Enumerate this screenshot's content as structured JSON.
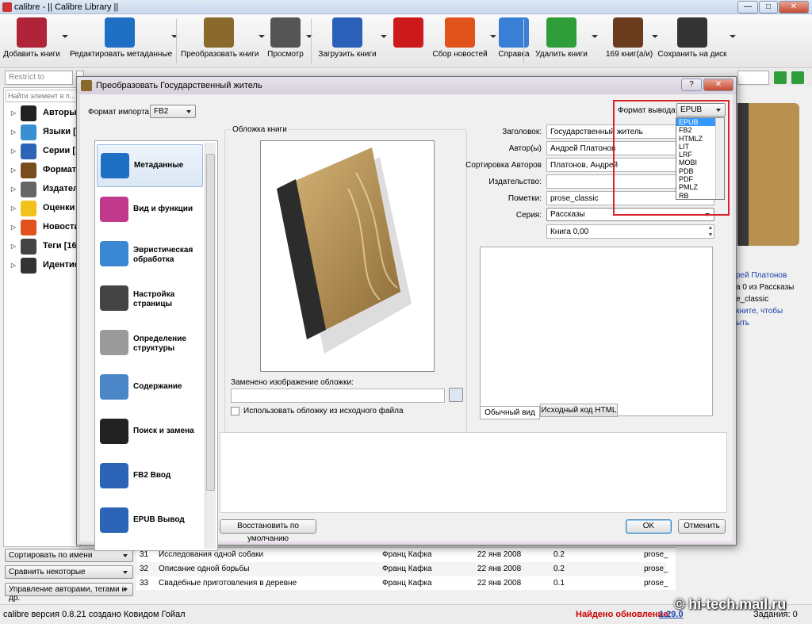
{
  "window": {
    "title": "calibre - || Calibre Library ||",
    "min": "—",
    "max": "□",
    "close": "✕"
  },
  "toolbar": [
    {
      "label": "Добавить книги",
      "icon": "add-book-icon",
      "color": "#b0243a",
      "arrow": true
    },
    {
      "label": "Редактировать метаданные",
      "icon": "info-icon",
      "color": "#1f6fc4",
      "arrow": true
    },
    {
      "label": "Преобразовать книги",
      "icon": "convert-icon",
      "color": "#8a6a2c",
      "arrow": true
    },
    {
      "label": "Просмотр",
      "icon": "magnifier-icon",
      "color": "#555555",
      "arrow": true
    },
    {
      "label": "Загрузить книги",
      "icon": "globe-icon",
      "color": "#2b5fb8",
      "arrow": true
    },
    {
      "label": "",
      "icon": "heart-icon",
      "color": "#cc1a1a",
      "arrow": false
    },
    {
      "label": "Сбор новостей",
      "icon": "news-icon",
      "color": "#e2521b",
      "arrow": true
    },
    {
      "label": "Справка",
      "icon": "help-icon",
      "color": "#3a7fd6",
      "arrow": false
    },
    {
      "label": "Удалить книги",
      "icon": "recycle-icon",
      "color": "#2e9d3a",
      "arrow": true
    },
    {
      "label": "169 книг(а/и)",
      "icon": "library-icon",
      "color": "#6b3b1d",
      "arrow": true
    },
    {
      "label": "Сохранить на диск",
      "icon": "save-disk-icon",
      "color": "#333333",
      "arrow": true
    }
  ],
  "search": {
    "restrict": "Restrict to",
    "filter_placeholder": "Найти элемент в п..."
  },
  "tags": [
    {
      "label": "Авторы [",
      "icon": "person-icon"
    },
    {
      "label": "Языки [2",
      "icon": "globe-icon"
    },
    {
      "label": "Серии [1",
      "icon": "series-icon"
    },
    {
      "label": "Форматы",
      "icon": "book-icon"
    },
    {
      "label": "Издатели",
      "icon": "typewriter-icon"
    },
    {
      "label": "Оценки",
      "icon": "star-icon"
    },
    {
      "label": "Новости",
      "icon": "news-icon"
    },
    {
      "label": "Теги [16]",
      "icon": "tag-icon"
    },
    {
      "label": "Идентиф",
      "icon": "barcode-icon"
    }
  ],
  "left_buttons": [
    "Сортировать по имени",
    "Сравнить некоторые",
    "Управление авторами, тегами и др."
  ],
  "books": [
    {
      "n": "31",
      "title": "Исследования одной собаки",
      "author": "Франц Кафка",
      "date": "22 янв 2008",
      "size": "0.2",
      "tag": "prose_"
    },
    {
      "n": "32",
      "title": "Описание одной борьбы",
      "author": "Франц Кафка",
      "date": "22 янв 2008",
      "size": "0.2",
      "tag": "prose_"
    },
    {
      "n": "33",
      "title": "Свадебные приготовления в деревне",
      "author": "Франц Кафка",
      "date": "22 янв 2008",
      "size": "0.1",
      "tag": "prose_"
    }
  ],
  "right_details": [
    "рей Платонов",
    "а 0 из Рассказы",
    "e_classic",
    "кните, чтобы",
    "ыть"
  ],
  "status": {
    "version": "calibre версия 0.8.21 создано Ковидом Гойал",
    "update_label": "Найдено обновление:",
    "update_version": "1.29.0",
    "jobs": "Задания: 0"
  },
  "watermark": "© hi-tech.mail.ru",
  "dialog": {
    "title": "Преобразовать Государственный житель",
    "help": "?",
    "close": "✕",
    "input_label": "Формат импорта:",
    "input_value": "FB2",
    "output_label": "Формат вывода:",
    "output_value": "EPUB",
    "output_options": [
      "EPUB",
      "FB2",
      "HTMLZ",
      "LIT",
      "LRF",
      "MOBI",
      "PDB",
      "PDF",
      "PMLZ",
      "RB"
    ],
    "sections": [
      {
        "label": "Метаданные",
        "icon": "info-icon",
        "color": "#1f6fc4"
      },
      {
        "label": "Вид и функции",
        "icon": "paint-icon",
        "color": "#c0398a"
      },
      {
        "label": "Эвристическая обработка",
        "icon": "heuristics-icon",
        "color": "#3a88d4"
      },
      {
        "label": "Настройка страницы",
        "icon": "gears-icon",
        "color": "#444444"
      },
      {
        "label": "Определение структуры",
        "icon": "document-icon",
        "color": "#9a9a9a"
      },
      {
        "label": "Содержание",
        "icon": "notebook-icon",
        "color": "#4a86c8"
      },
      {
        "label": "Поиск и замена",
        "icon": "binoculars-icon",
        "color": "#222222"
      },
      {
        "label": "FB2 Ввод",
        "icon": "arrow-right-icon",
        "color": "#2c65b8"
      },
      {
        "label": "EPUB Вывод",
        "icon": "arrow-left-icon",
        "color": "#2c65b8"
      }
    ],
    "cover_group": "Обложка книги",
    "cover_changed_label": "Заменено изображение обложки:",
    "use_source_cover": "Использовать обложку из исходного файла",
    "fields": [
      {
        "label": "Заголовок:",
        "value": "Государственный житель"
      },
      {
        "label": "Автор(ы)",
        "value": "Андрей Платонов"
      },
      {
        "label": "Сортировка Авторов",
        "value": "Платонов, Андрей"
      },
      {
        "label": "Издательство:",
        "value": ""
      },
      {
        "label": "Пометки:",
        "value": "prose_classic"
      },
      {
        "label": "Серия:",
        "value": "Рассказы"
      }
    ],
    "book_number": "Книга 0,00",
    "tabs": [
      "Обычный вид",
      "Исходный код HTML"
    ],
    "restore": "Восстановить по умолчанию",
    "ok": "OK",
    "cancel": "Отменить"
  }
}
